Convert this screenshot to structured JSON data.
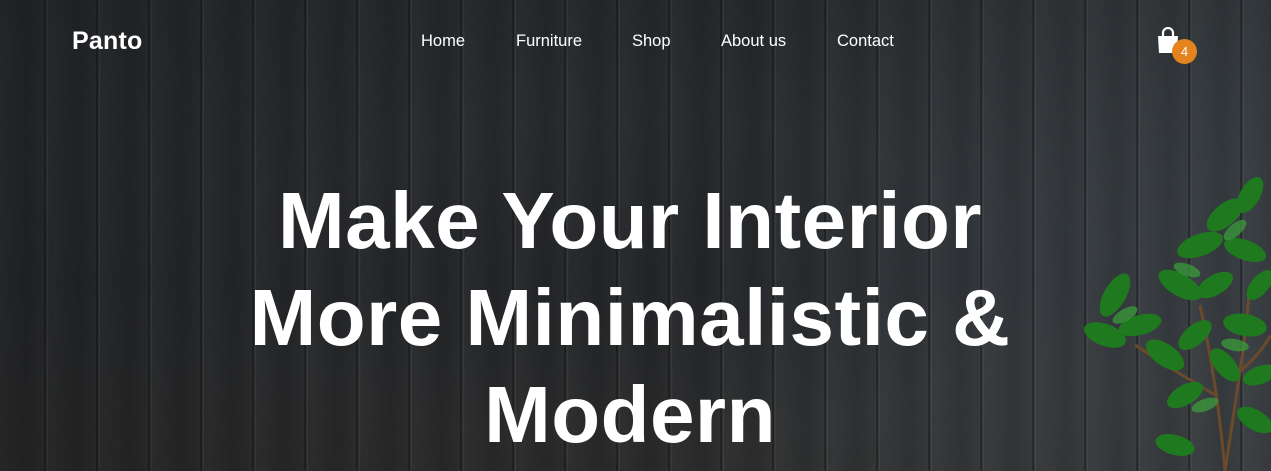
{
  "brand": {
    "name": "Panto"
  },
  "nav": {
    "items": [
      {
        "label": "Home"
      },
      {
        "label": "Furniture"
      },
      {
        "label": "Shop"
      },
      {
        "label": "About us"
      },
      {
        "label": "Contact"
      }
    ]
  },
  "cart": {
    "icon": "shopping-bag-icon",
    "count": "4",
    "badge_color": "#e5831f"
  },
  "hero": {
    "headline_lines": [
      "Make Your Interior",
      "More Minimalistic &",
      "Modern"
    ]
  },
  "colors": {
    "text": "#ffffff",
    "background": "#24272a"
  }
}
